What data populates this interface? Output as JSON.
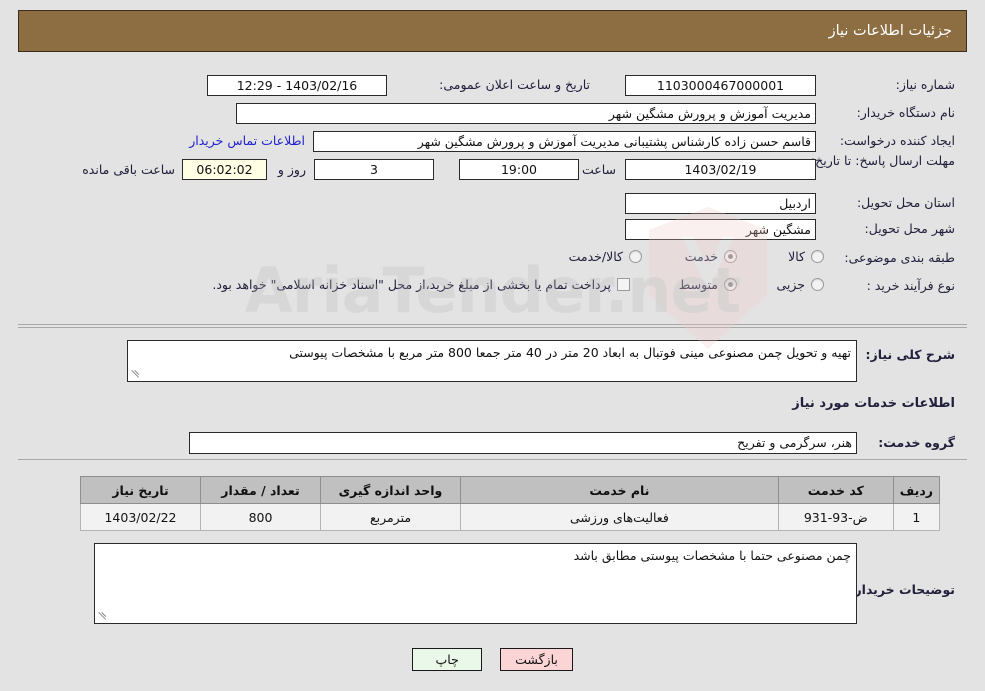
{
  "header": {
    "title": "جزئیات اطلاعات نیاز"
  },
  "watermark": {
    "text": "AriaTender.net"
  },
  "general": {
    "need_number_label": "شماره نیاز:",
    "need_number_value": "1103000467000001",
    "announce_datetime_label": "تاریخ و ساعت اعلان عمومی:",
    "announce_datetime_value": "1403/02/16 - 12:29",
    "buyer_org_label": "نام دستگاه خریدار:",
    "buyer_org_value": "مدیریت آموزش و پرورش مشگین شهر",
    "requester_label": "ایجاد کننده درخواست:",
    "requester_value": "قاسم  حسن زاده کارشناس پشتیبانی مدیریت آموزش و پرورش مشگین شهر",
    "contact_link": "اطلاعات تماس خریدار",
    "deadline_label": "مهلت ارسال پاسخ: تا تاریخ:",
    "deadline_date": "1403/02/19",
    "deadline_time_label": "ساعت",
    "deadline_time": "19:00",
    "remaining_days": "3",
    "remaining_days_label": "روز و",
    "remaining_clock": "06:02:02",
    "remaining_clock_label": "ساعت باقی مانده",
    "province_label": "استان محل تحویل:",
    "province_value": "اردبیل",
    "city_label": "شهر محل تحویل:",
    "city_value": "مشگین شهر",
    "category_label": "طبقه بندی موضوعی:",
    "category_options": [
      {
        "label": "کالا",
        "selected": false
      },
      {
        "label": "خدمت",
        "selected": true
      },
      {
        "label": "کالا/خدمت",
        "selected": false
      }
    ],
    "purchase_type_label": "نوع فرآیند خرید :",
    "purchase_type_options": [
      {
        "label": "جزیی",
        "selected": false
      },
      {
        "label": "متوسط",
        "selected": true
      }
    ],
    "treasury_checkbox_label": "پرداخت تمام یا بخشی از مبلغ خرید،از محل \"اسناد خزانه اسلامی\" خواهد بود.",
    "treasury_checked": false
  },
  "description": {
    "label": "شرح کلی نیاز:",
    "value": "تهیه و تحویل چمن مصنوعی مینی فوتبال به ابعاد 20 متر در 40 متر جمعا 800 متر مربع با مشخصات پیوستی",
    "services_section_title": "اطلاعات خدمات مورد نیاز",
    "service_group_label": "گروه خدمت:",
    "service_group_value": "هنر، سرگرمی و تفریح"
  },
  "table": {
    "columns": [
      "ردیف",
      "کد خدمت",
      "نام خدمت",
      "واحد اندازه گیری",
      "تعداد / مقدار",
      "تاریخ نیاز"
    ],
    "rows": [
      {
        "index": "1",
        "service_code": "ض-93-931",
        "service_name": "فعالیت‌های ورزشی",
        "unit": "مترمربع",
        "quantity": "800",
        "need_date": "1403/02/22"
      }
    ]
  },
  "buyer_notes": {
    "label": "توضیحات خریدار:",
    "value": "چمن مصنوعی حتما با مشخصات پیوستی مطابق باشد"
  },
  "footer": {
    "print_label": "چاپ",
    "back_label": "بازگشت"
  }
}
